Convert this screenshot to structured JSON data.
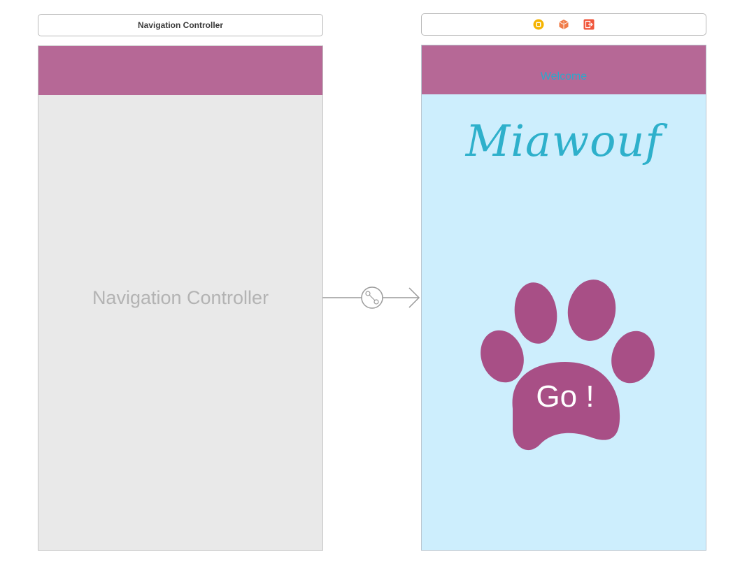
{
  "left_scene": {
    "title": "Navigation Controller",
    "placeholder": "Navigation Controller",
    "navbar_color": "#b66896"
  },
  "segue": {
    "icon": "segue-link-icon"
  },
  "right_scene": {
    "dock_icons": [
      "view-controller-icon",
      "first-responder-icon",
      "exit-icon"
    ],
    "nav_title": "Welcome",
    "logo": "Miawouf",
    "button_label": "Go !",
    "colors": {
      "navbar": "#b66896",
      "background": "#cdeefd",
      "title": "#2fa7c9",
      "paw": "#a84f86"
    }
  }
}
